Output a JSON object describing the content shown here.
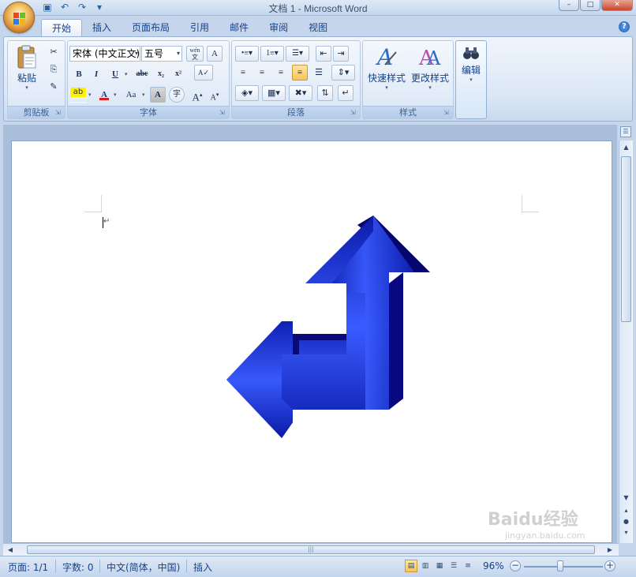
{
  "window": {
    "title": "文档 1 - Microsoft Word"
  },
  "qat": {
    "icons": [
      "save-icon",
      "undo-icon",
      "redo-icon",
      "customize-icon"
    ]
  },
  "tabs": [
    "开始",
    "插入",
    "页面布局",
    "引用",
    "邮件",
    "审阅",
    "视图"
  ],
  "ribbon": {
    "clipboard": {
      "label": "剪贴板",
      "paste_label": "粘贴"
    },
    "font": {
      "label": "字体",
      "font_name": "宋体 (中文正文)",
      "font_size": "五号",
      "bold": "B",
      "italic": "I",
      "underline": "U",
      "strike": "abc",
      "subscript": "x₂",
      "superscript": "x²",
      "grow": "A",
      "shrink": "A",
      "case": "Aa",
      "char_shade": "A",
      "font_color": "A",
      "phonetic": "wén",
      "enclose": "字"
    },
    "paragraph": {
      "label": "段落"
    },
    "styles": {
      "label": "样式",
      "quick_styles": "快速样式",
      "change_styles": "更改样式"
    },
    "editing": {
      "label": "编辑"
    }
  },
  "statusbar": {
    "page": "页面: 1/1",
    "words": "字数: 0",
    "language": "中文(简体，中国)",
    "mode": "插入",
    "zoom": "96%",
    "zoom_value": 0.96
  },
  "watermark": {
    "brand": "Baidu经验",
    "url": "jingyan.baidu.com"
  },
  "colors": {
    "accent": "#15428b",
    "shape_blue": "#1a2fd6",
    "shape_dark": "#0a0a7a"
  }
}
